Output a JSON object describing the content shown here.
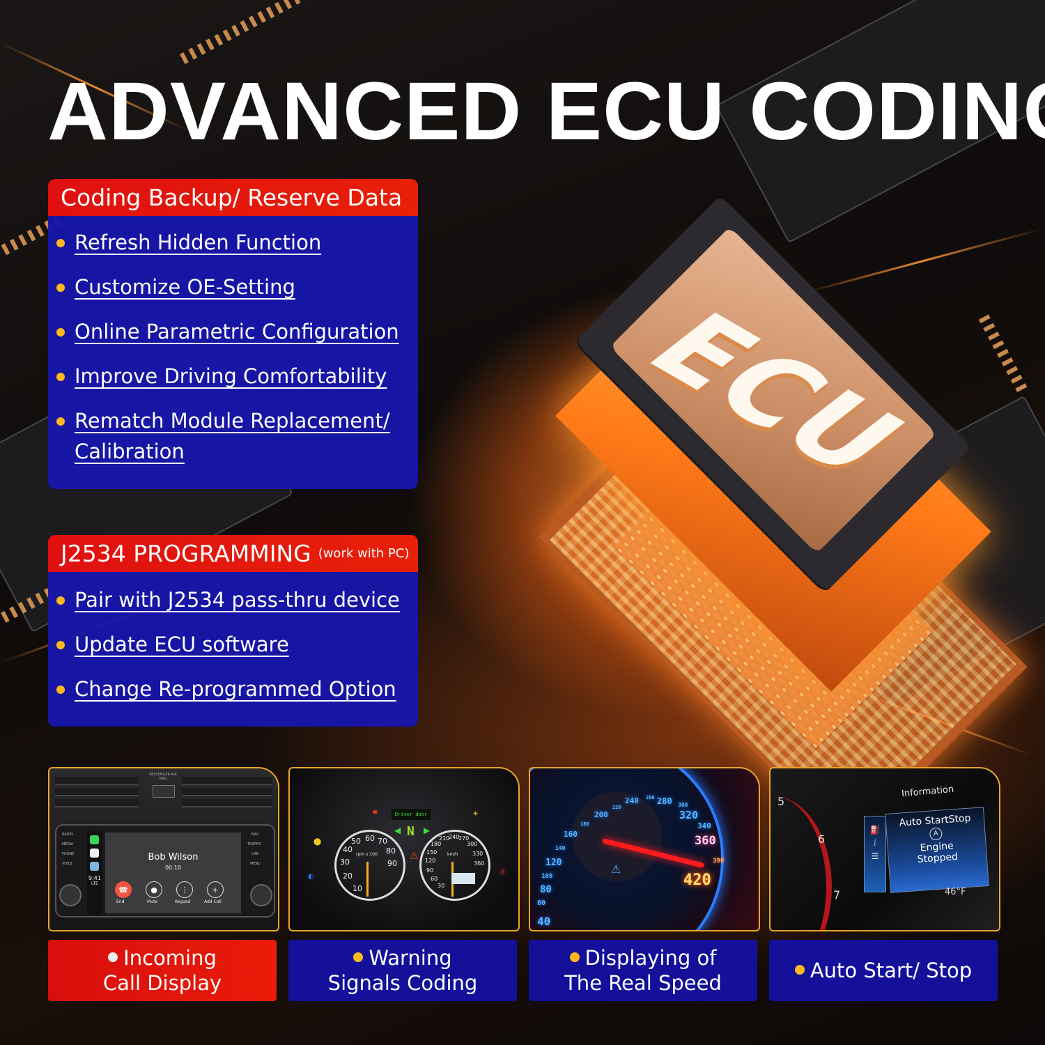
{
  "title": "ADVANCED ECU CODING",
  "chip_label": "ECU",
  "panels": [
    {
      "heading": "Coding Backup/ Reserve Data",
      "heading_note": "",
      "items": [
        "Refresh Hidden Function",
        "Customize OE-Setting",
        "Online Parametric Configuration",
        "Improve Driving Comfortability",
        "Rematch Module Replacement/",
        "Calibration"
      ]
    },
    {
      "heading": "J2534 PROGRAMMING",
      "heading_note": "(work with PC)",
      "items": [
        "Pair with J2534 pass-thru device",
        "Update ECU software",
        "Change Re-programmed Option"
      ]
    }
  ],
  "features": [
    {
      "line1": "Incoming",
      "line2": "Call Display",
      "style": "red",
      "image": {
        "caller": "Bob Wilson",
        "duration": "00:10",
        "clock": "9:41",
        "network": "LTE",
        "airbag_label": "PASSENGER AIR BAG",
        "left_buttons": [
          "RADIO",
          "MEDIA",
          "PHONE",
          "VOICE"
        ],
        "right_buttons": [
          "NAV",
          "TRAFFIC",
          "CAR",
          "MENU"
        ],
        "call_buttons": [
          "End",
          "Mute",
          "Keypad",
          "Add Call"
        ]
      }
    },
    {
      "line1": "Warning",
      "line2": "Signals Coding",
      "style": "blue",
      "image": {
        "display_text": "Driver door",
        "gear": "N",
        "tach_label": "rpm x 100",
        "tach_ticks": [
          "10",
          "20",
          "30",
          "40",
          "50",
          "60",
          "70",
          "80",
          "90"
        ],
        "speed_label": "km/h",
        "speed_ticks": [
          "30",
          "60",
          "90",
          "120",
          "150",
          "180",
          "210",
          "240",
          "270",
          "300",
          "330",
          "360"
        ]
      }
    },
    {
      "line1": "Displaying of",
      "line2": "The Real Speed",
      "style": "blue",
      "image": {
        "speed_ticks": [
          "40",
          "60",
          "80",
          "100",
          "120",
          "140",
          "160",
          "180",
          "200",
          "220",
          "240",
          "260",
          "280",
          "300",
          "320",
          "340",
          "360",
          "390"
        ],
        "current_speed": "420"
      }
    },
    {
      "line1": "Auto Start/ Stop",
      "line2": "",
      "style": "blue",
      "image": {
        "header": "Information",
        "title": "Auto StartStop",
        "icon": "A",
        "status_line1": "Engine",
        "status_line2": "Stopped",
        "temperature": "46°F",
        "rpm_ticks": [
          "5",
          "6",
          "7"
        ]
      }
    }
  ],
  "colors": {
    "accent_red": "#E41212",
    "panel_blue": "#1816AA",
    "bullet_yellow": "#FFB81C",
    "card_border": "#E8A62A"
  }
}
